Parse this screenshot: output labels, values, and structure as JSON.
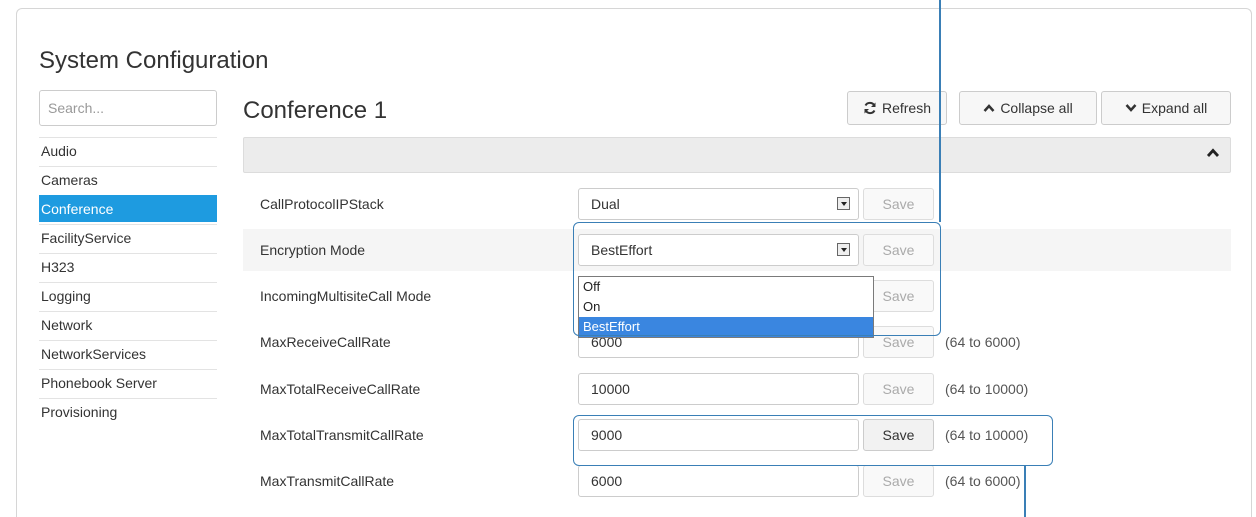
{
  "page": {
    "title": "System Configuration"
  },
  "search": {
    "placeholder": "Search..."
  },
  "sidebar": {
    "items": [
      {
        "label": "Audio"
      },
      {
        "label": "Cameras"
      },
      {
        "label": "Conference",
        "active": true
      },
      {
        "label": "FacilityService"
      },
      {
        "label": "H323"
      },
      {
        "label": "Logging"
      },
      {
        "label": "Network"
      },
      {
        "label": "NetworkServices"
      },
      {
        "label": "Phonebook Server"
      },
      {
        "label": "Provisioning"
      }
    ]
  },
  "main": {
    "section_title": "Conference 1",
    "toolbar": {
      "refresh_label": "Refresh",
      "collapse_label": "Collapse all",
      "expand_label": "Expand all"
    },
    "settings": [
      {
        "label": "CallProtocolIPStack",
        "type": "select",
        "value": "Dual",
        "save_label": "Save",
        "save_enabled": false,
        "range": ""
      },
      {
        "label": "Encryption Mode",
        "type": "select",
        "value": "BestEffort",
        "save_label": "Save",
        "save_enabled": false,
        "range": "",
        "dropdown_open": true
      },
      {
        "label": "IncomingMultisiteCall Mode",
        "type": "select",
        "value": "",
        "save_label": "Save",
        "save_enabled": false,
        "range": ""
      },
      {
        "label": "MaxReceiveCallRate",
        "type": "text",
        "value": "6000",
        "save_label": "Save",
        "save_enabled": false,
        "range": "(64 to 6000)"
      },
      {
        "label": "MaxTotalReceiveCallRate",
        "type": "text",
        "value": "10000",
        "save_label": "Save",
        "save_enabled": false,
        "range": "(64 to 10000)"
      },
      {
        "label": "MaxTotalTransmitCallRate",
        "type": "text",
        "value": "9000",
        "save_label": "Save",
        "save_enabled": true,
        "range": "(64 to 10000)"
      },
      {
        "label": "MaxTransmitCallRate",
        "type": "text",
        "value": "6000",
        "save_label": "Save",
        "save_enabled": false,
        "range": "(64 to 6000)"
      }
    ],
    "encryption_dropdown": {
      "options": [
        "Off",
        "On",
        "BestEffort"
      ],
      "selected": "BestEffort"
    }
  },
  "colors": {
    "accent": "#1e9be0",
    "callout": "#3a7fb6",
    "dropdown_highlight": "#3a86e0"
  },
  "icons": {
    "refresh": "refresh-icon",
    "collapse": "chevron-up-icon",
    "expand": "chevron-down-icon",
    "panel_toggle": "chevron-up-icon"
  }
}
